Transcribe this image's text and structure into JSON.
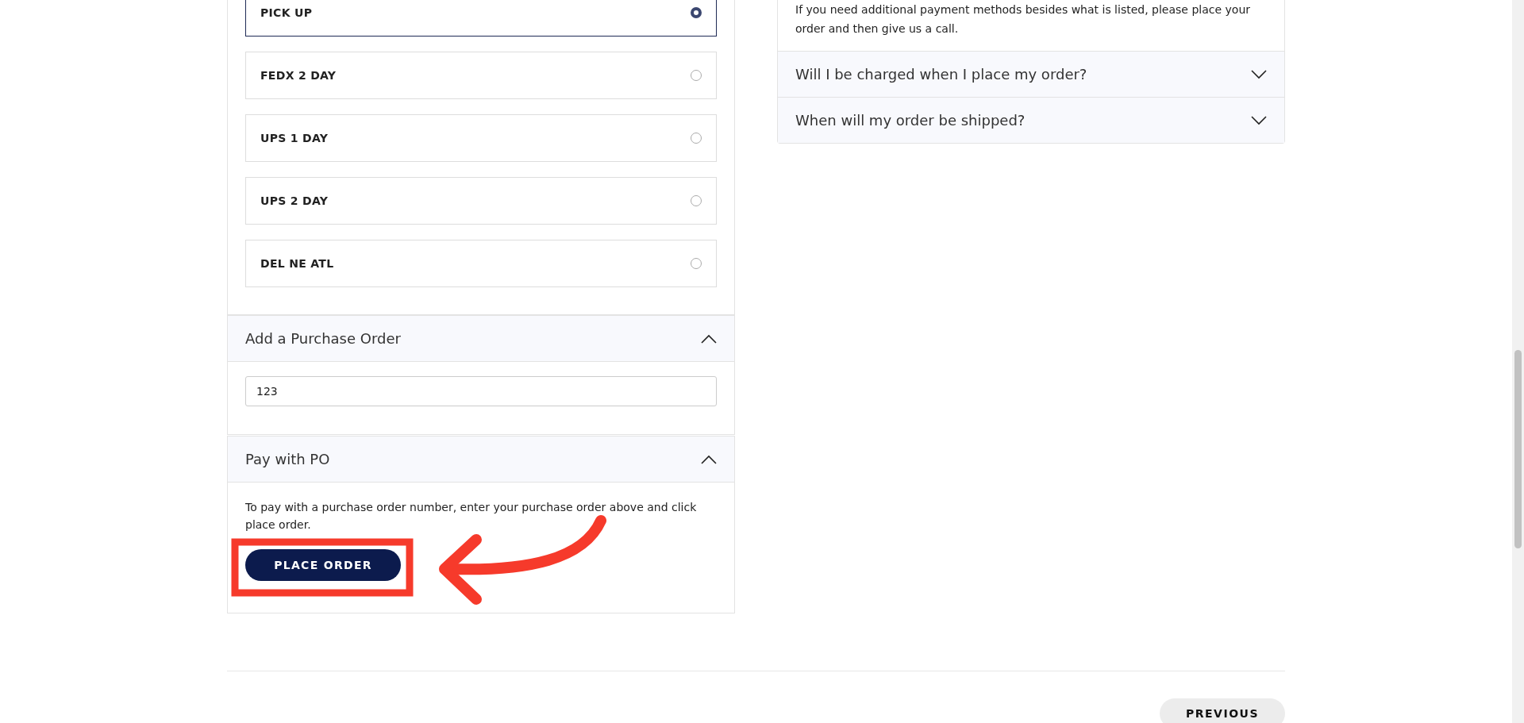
{
  "shipping_options": [
    {
      "label": "PICK UP",
      "selected": true
    },
    {
      "label": "FEDX 2 DAY",
      "selected": false
    },
    {
      "label": "UPS 1 DAY",
      "selected": false
    },
    {
      "label": "UPS 2 DAY",
      "selected": false
    },
    {
      "label": "DEL NE ATL",
      "selected": false
    }
  ],
  "purchase_order": {
    "title": "Add a Purchase Order",
    "expanded": true,
    "value": "123"
  },
  "pay_with_po": {
    "title": "Pay with PO",
    "expanded": true,
    "text": "To pay with a purchase order number, enter your purchase order above and click place order.",
    "button": "PLACE ORDER"
  },
  "faq": {
    "text": "If you need additional payment methods besides what is listed, please place your order and then give us a call.",
    "items": [
      {
        "question": "Will I be charged when I place my order?",
        "expanded": false
      },
      {
        "question": "When will my order be shipped?",
        "expanded": false
      }
    ]
  },
  "previous_button": "PREVIOUS"
}
